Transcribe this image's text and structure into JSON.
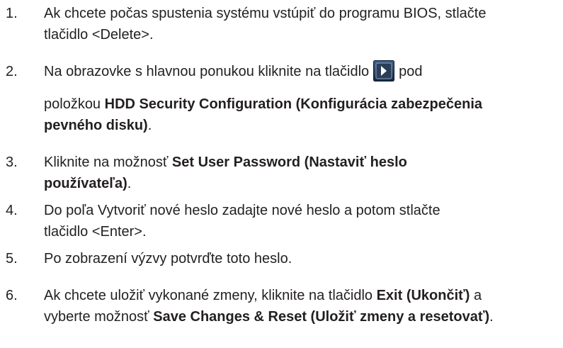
{
  "steps": [
    {
      "number": "1.",
      "line1": "Ak chcete počas spustenia systému vstúpiť do programu BIOS, stlačte",
      "line2": "tlačidlo <Delete>."
    },
    {
      "number": "2.",
      "line1_before": "Na obrazovke s hlavnou ponukou kliknite na tlačidlo",
      "line1_after": "pod",
      "line2_prefix": "položkou ",
      "line2_bold": "HDD Security Configuration (Konfigurácia zabezpečenia",
      "line3_bold": "pevného disku)",
      "line3_suffix": ".",
      "icon": "chevron-right-icon"
    },
    {
      "number": "3.",
      "line1_prefix": "Kliknite na možnosť ",
      "line1_bold": "Set User Password (Nastaviť heslo",
      "line2_bold": "používateľa)",
      "line2_suffix": "."
    },
    {
      "number": "4.",
      "line1": "Do poľa Vytvoriť nové heslo zadajte nové heslo a potom stlačte",
      "line2": "tlačidlo <Enter>."
    },
    {
      "number": "5.",
      "line1": "Po zobrazení výzvy potvrďte toto heslo."
    },
    {
      "number": "6.",
      "line1_prefix": "Ak chcete uložiť vykonané zmeny, kliknite na tlačidlo ",
      "line1_bold": "Exit (Ukončiť)",
      "line1_suffix": " a",
      "line2_prefix": "vyberte možnosť ",
      "line2_bold": "Save Changes & Reset (Uložiť zmeny a resetovať)",
      "line2_suffix": "."
    }
  ],
  "colors": {
    "text": "#231f20",
    "icon_background": "#1f3a5c",
    "icon_arrow": "#ffffff"
  }
}
